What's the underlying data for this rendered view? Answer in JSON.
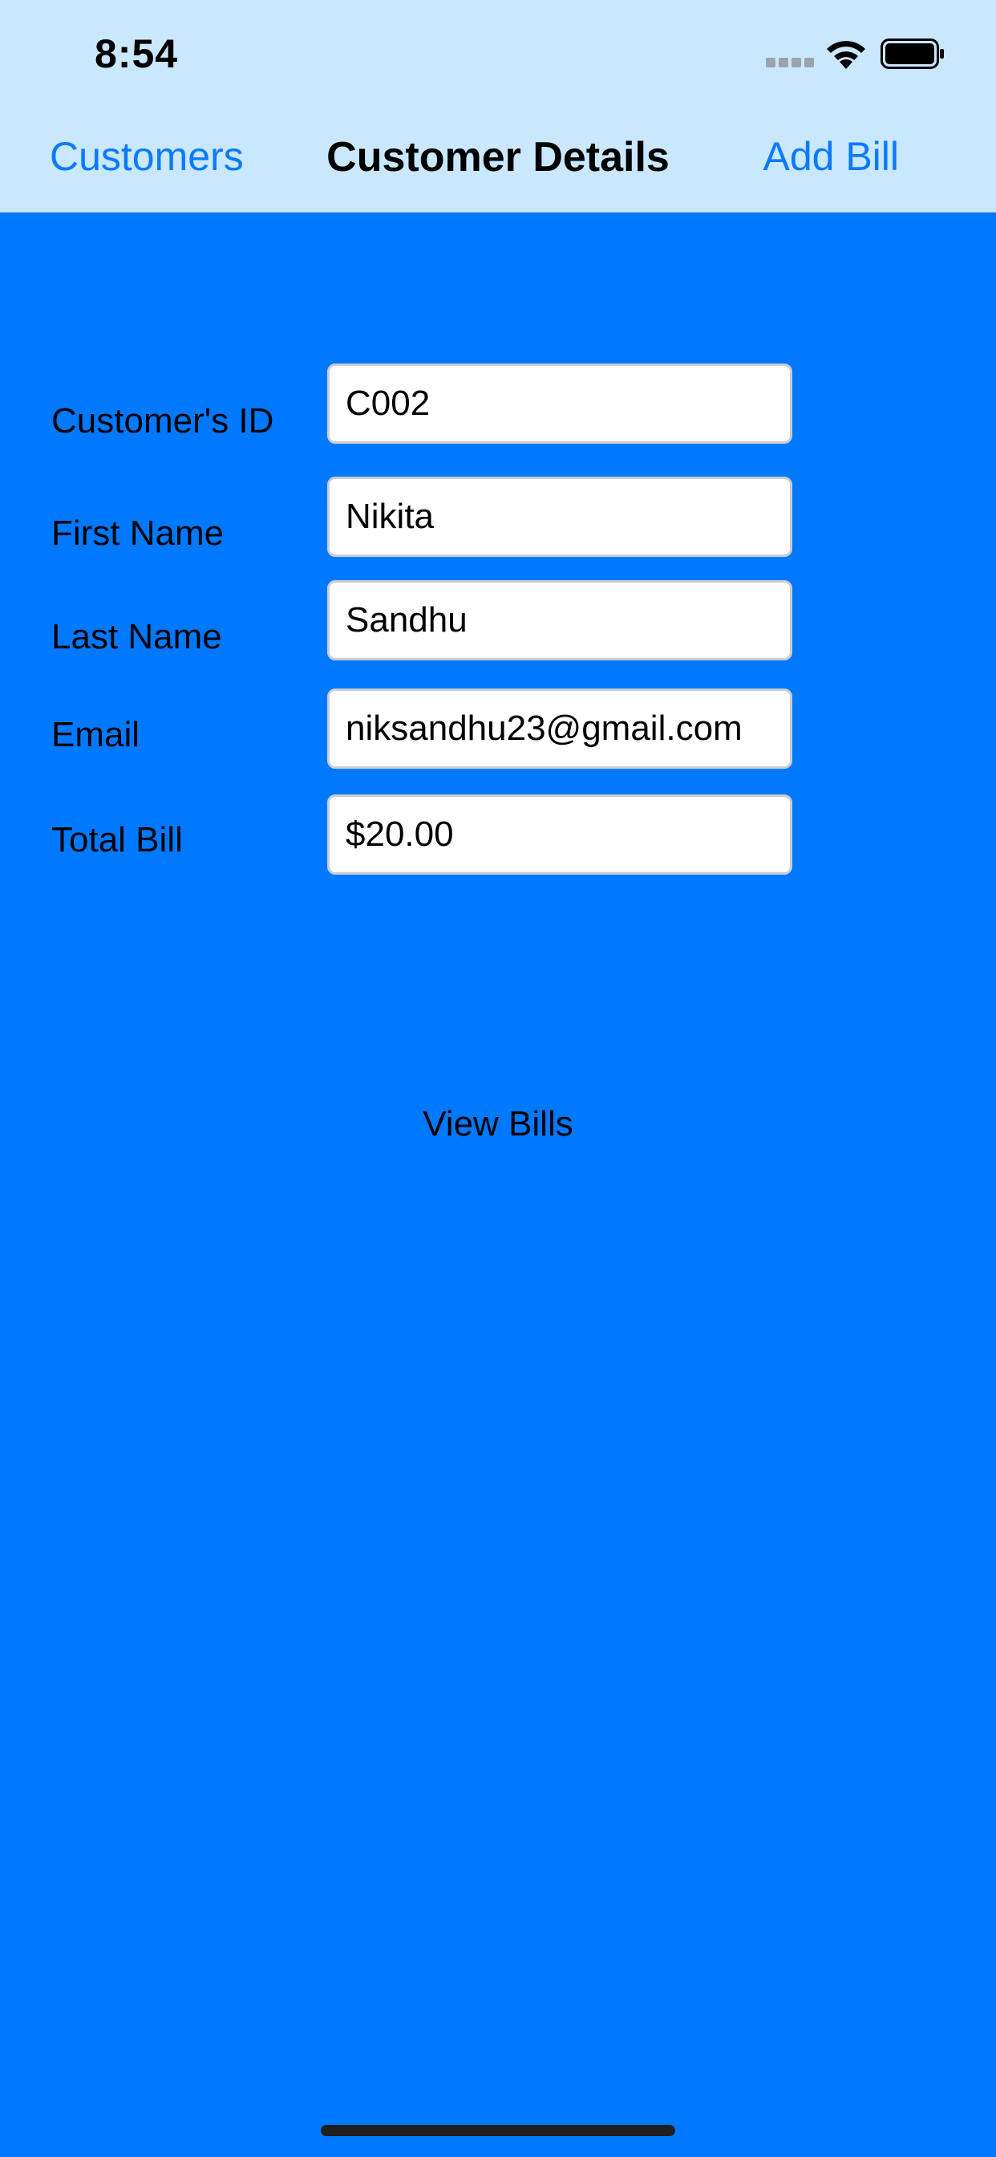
{
  "status_bar": {
    "time": "8:54"
  },
  "nav": {
    "back_label": "Customers",
    "title": "Customer Details",
    "action_label": "Add Bill"
  },
  "form": {
    "fields": [
      {
        "label": "Customer's ID",
        "value": "C002"
      },
      {
        "label": "First Name",
        "value": "Nikita"
      },
      {
        "label": "Last Name",
        "value": "Sandhu"
      },
      {
        "label": "Email",
        "value": "niksandhu23@gmail.com"
      },
      {
        "label": "Total Bill",
        "value": "$20.00"
      }
    ]
  },
  "actions": {
    "view_bills_label": "View Bills"
  },
  "colors": {
    "background": "#0079FF",
    "header_background": "#C9E7FD",
    "nav_link": "#0A7AFF"
  }
}
